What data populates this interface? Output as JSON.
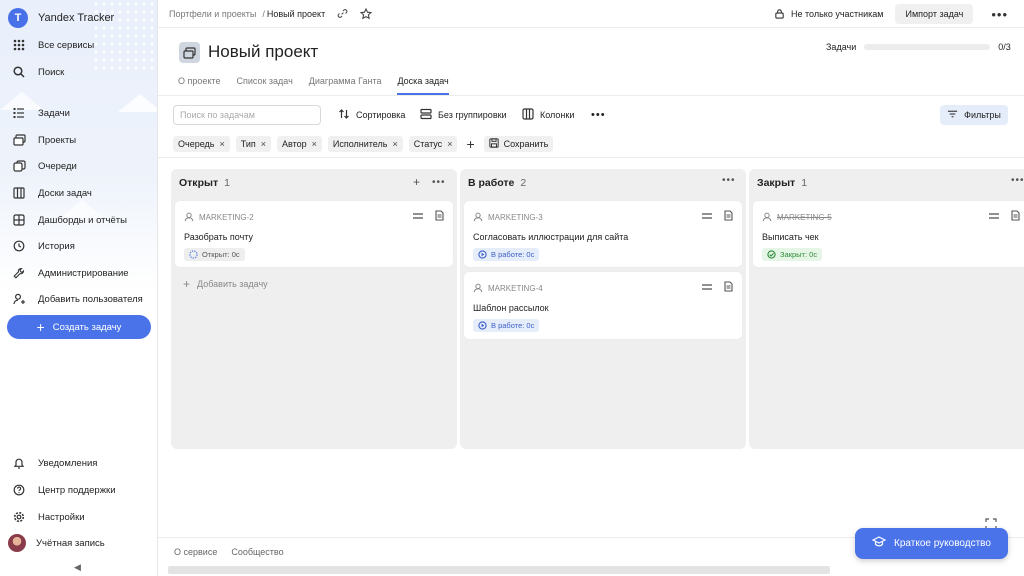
{
  "sidebar": {
    "app_name": "Yandex Tracker",
    "logo_letter": "T",
    "items": [
      {
        "label": "Все сервисы",
        "icon": "grid-icon"
      },
      {
        "label": "Поиск",
        "icon": "search-icon"
      },
      {
        "label": "Задачи",
        "icon": "tasks-icon"
      },
      {
        "label": "Проекты",
        "icon": "projects-icon"
      },
      {
        "label": "Очереди",
        "icon": "queues-icon"
      },
      {
        "label": "Доски задач",
        "icon": "boards-icon"
      },
      {
        "label": "Дашборды и отчёты",
        "icon": "dashboards-icon"
      },
      {
        "label": "История",
        "icon": "history-icon"
      },
      {
        "label": "Администрирование",
        "icon": "wrench-icon"
      },
      {
        "label": "Добавить пользователя",
        "icon": "add-user-icon"
      }
    ],
    "create_label": "Создать задачу",
    "bottom_items": [
      {
        "label": "Уведомления",
        "icon": "bell-icon"
      },
      {
        "label": "Центр поддержки",
        "icon": "help-icon"
      },
      {
        "label": "Настройки",
        "icon": "gear-icon"
      },
      {
        "label": "Учётная запись",
        "icon": "avatar"
      }
    ],
    "collapse_glyph": "◀"
  },
  "topbar": {
    "crumb_parent": "Портфели и проекты",
    "crumb_sep": "/",
    "crumb_current": "Новый проект",
    "members_label": "Не только участникам",
    "import_label": "Импорт задач",
    "more_glyph": "•••"
  },
  "header": {
    "title": "Новый проект",
    "progress_label": "Задачи",
    "progress_value": "0/3",
    "progress_fraction": 0
  },
  "tabs": [
    {
      "label": "О проекте",
      "active": false
    },
    {
      "label": "Список задач",
      "active": false
    },
    {
      "label": "Диаграмма Ганта",
      "active": false
    },
    {
      "label": "Доска задач",
      "active": true
    }
  ],
  "toolbar": {
    "search_placeholder": "Поиск по задачам",
    "sort_label": "Сортировка",
    "group_label": "Без группировки",
    "columns_label": "Колонки",
    "more_glyph": "•••",
    "filters_label": "Фильтры"
  },
  "chips": [
    "Очередь",
    "Тип",
    "Автор",
    "Исполнитель",
    "Статус"
  ],
  "chip_close": "×",
  "chip_add": "+",
  "save_label": "Сохранить",
  "columns": [
    {
      "title": "Открыт",
      "count": "1",
      "cards": [
        {
          "key": "MARKETING-2",
          "summary": "Разобрать почту",
          "status": "Открыт: 0с",
          "kind": "open"
        }
      ],
      "add_label": "Добавить задачу"
    },
    {
      "title": "В работе",
      "count": "2",
      "cards": [
        {
          "key": "MARKETING-3",
          "summary": "Согласовать иллюстрации для сайта",
          "status": "В работе: 0с",
          "kind": "prog"
        },
        {
          "key": "MARKETING-4",
          "summary": "Шаблон рассылок",
          "status": "В работе: 0с",
          "kind": "prog"
        }
      ]
    },
    {
      "title": "Закрыт",
      "count": "1",
      "cards": [
        {
          "key": "MARKETING-5",
          "summary": "Выписать чек",
          "status": "Закрыт: 0с",
          "kind": "done"
        }
      ]
    }
  ],
  "footer": {
    "about": "О сервисе",
    "community": "Сообщество",
    "guide_label": "Краткое руководство"
  },
  "colors": {
    "accent": "#4a73ea",
    "column_bg": "#efefef",
    "done_green": "#2f8a3a"
  }
}
